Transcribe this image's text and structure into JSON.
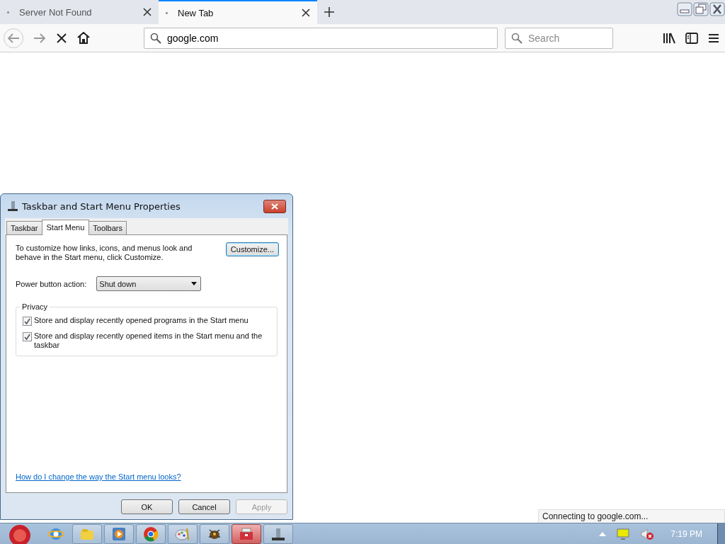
{
  "browser": {
    "tabs": [
      {
        "title": "Server Not Found",
        "selected": false
      },
      {
        "title": "New Tab",
        "selected": true
      }
    ],
    "address": "google.com",
    "search_placeholder": "Search",
    "loading": true,
    "status": "Connecting to google.com..."
  },
  "dialog": {
    "title": "Taskbar and Start Menu Properties",
    "tabs": [
      {
        "label": "Taskbar",
        "selected": false
      },
      {
        "label": "Start Menu",
        "selected": true
      },
      {
        "label": "Toolbars",
        "selected": false
      }
    ],
    "description": "To customize how links, icons, and menus look and behave in the Start menu, click Customize.",
    "customize_button": "Customize...",
    "power_label": "Power button action:",
    "power_value": "Shut down",
    "privacy": {
      "legend": "Privacy",
      "options": [
        {
          "label": "Store and display recently opened programs in the Start menu",
          "checked": true
        },
        {
          "label": "Store and display recently opened items in the Start menu and the taskbar",
          "checked": true
        }
      ]
    },
    "help_link": "How do I change the way the Start menu looks?",
    "buttons": [
      {
        "label": "OK",
        "disabled": false
      },
      {
        "label": "Cancel",
        "disabled": false
      },
      {
        "label": "Apply",
        "disabled": true
      }
    ]
  },
  "taskbar": {
    "apps": [
      {
        "kind": "browser",
        "selected": false
      },
      {
        "kind": "folder",
        "selected": false
      },
      {
        "kind": "media",
        "selected": false
      },
      {
        "kind": "chrome",
        "selected": false
      },
      {
        "kind": "paint",
        "selected": false
      },
      {
        "kind": "bug",
        "selected": false
      },
      {
        "kind": "toolbox",
        "selected": true
      },
      {
        "kind": "properties",
        "selected": false
      }
    ],
    "clock": "7:19 PM"
  }
}
